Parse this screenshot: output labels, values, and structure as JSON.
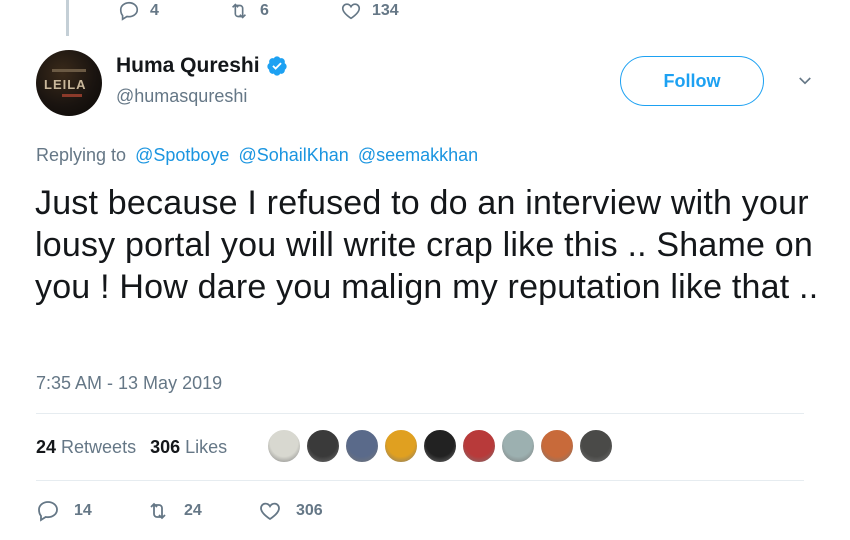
{
  "prev_tweet_actions": {
    "replies": "4",
    "retweets": "6",
    "likes": "134"
  },
  "author": {
    "display_name": "Huma Qureshi",
    "handle": "@humasqureshi",
    "avatar_text": "LEILA",
    "verified": true
  },
  "follow_label": "Follow",
  "replying_prefix": "Replying to",
  "mentions": [
    "@Spotboye",
    "@SohailKhan",
    "@seemakkhan"
  ],
  "tweet_text": "Just because I refused to do an interview with your lousy portal you will write crap like this .. Shame on you ! How dare you malign my reputation like that ..",
  "timestamp": "7:35 AM - 13 May 2019",
  "stats": {
    "retweets_count": "24",
    "retweets_label": "Retweets",
    "likes_count": "306",
    "likes_label": "Likes"
  },
  "liker_avatars": [
    "#d8d8d0",
    "#3a3a3a",
    "#5a6a8a",
    "#e0a020",
    "#222222",
    "#b83a3a",
    "#9cb0b0",
    "#c86a3a",
    "#4a4a48"
  ],
  "actions": {
    "replies": "14",
    "retweets": "24",
    "likes": "306"
  },
  "colors": {
    "accent": "#1da1f2",
    "muted": "#657786",
    "text": "#14171a"
  }
}
